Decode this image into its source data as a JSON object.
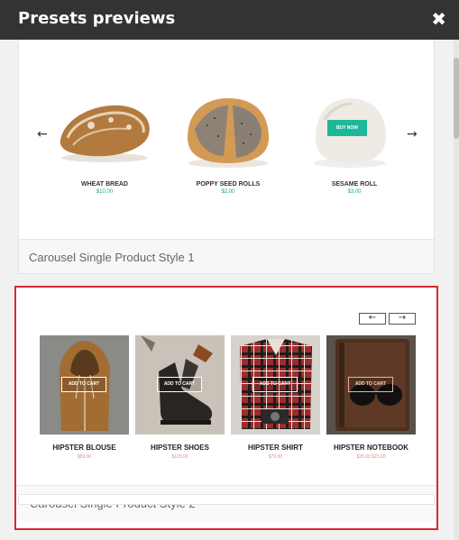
{
  "dialog": {
    "title": "Presets previews",
    "close_glyph": "✖"
  },
  "arrows": {
    "prev": "←",
    "next": "→"
  },
  "carousel1": {
    "label": "Carousel Single Product Style 1",
    "products": [
      {
        "name": "WHEAT BREAD",
        "price": "$10.00"
      },
      {
        "name": "POPPY SEED ROLLS",
        "price": "$2.00"
      },
      {
        "name": "SESAME ROLL",
        "price": "$3.00",
        "hover_button": "BUY NOW"
      }
    ],
    "accent": "#1db89a"
  },
  "carousel2": {
    "label": "Carousel Single Product Style 2",
    "add_to_cart": "ADD TO CART",
    "products": [
      {
        "name": "HIPSTER BLOUSE",
        "price": "$59.00"
      },
      {
        "name": "HIPSTER SHOES",
        "price": "$129.00"
      },
      {
        "name": "HIPSTER SHIRT",
        "price": "$79.00"
      },
      {
        "name": "HIPSTER NOTEBOOK",
        "price": "$25.00 $23.00"
      }
    ],
    "highlight_color": "#d22a35"
  }
}
